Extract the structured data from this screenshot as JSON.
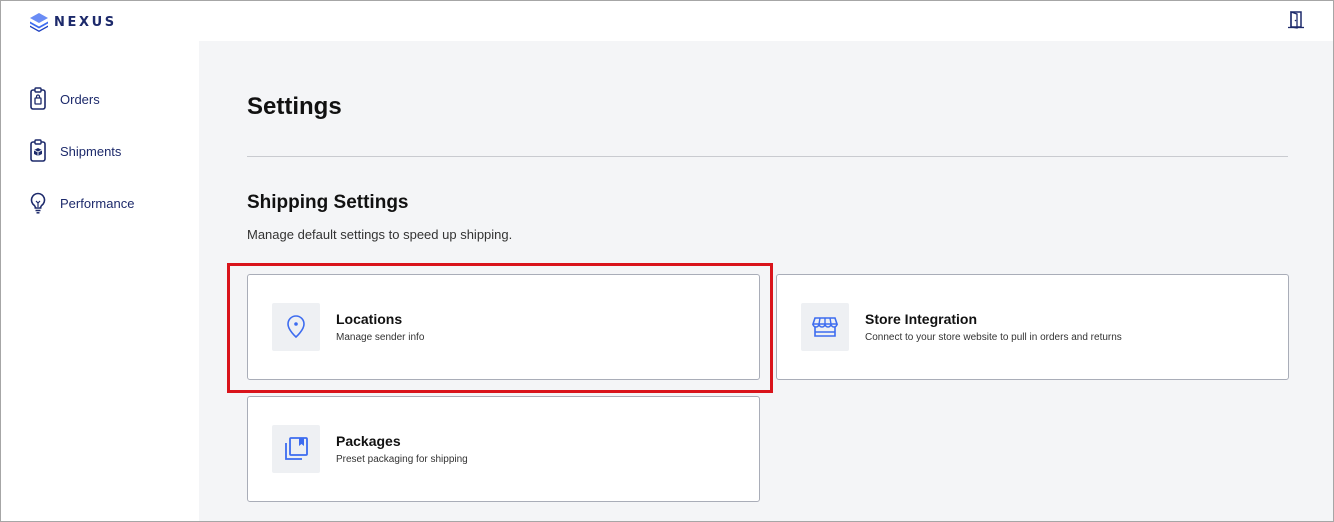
{
  "app": {
    "brand": "NEXUS",
    "brand_color": "#1d2a6b",
    "accent_color": "#3d6cf0"
  },
  "header": {
    "exit_icon": "door-exit-icon"
  },
  "sidebar": {
    "items": [
      {
        "label": "Orders",
        "icon": "clipboard-bag-icon"
      },
      {
        "label": "Shipments",
        "icon": "clipboard-box-icon"
      },
      {
        "label": "Performance",
        "icon": "lightbulb-icon"
      }
    ]
  },
  "main": {
    "title": "Settings",
    "section": {
      "title": "Shipping Settings",
      "subtitle": "Manage default settings to speed up shipping."
    },
    "cards": [
      {
        "title": "Locations",
        "description": "Manage sender info",
        "icon": "location-pin-icon",
        "highlighted": true
      },
      {
        "title": "Store Integration",
        "description": "Connect to your store website to pull in orders and returns",
        "icon": "storefront-icon",
        "highlighted": false
      },
      {
        "title": "Packages",
        "description": "Preset packaging for shipping",
        "icon": "packages-icon",
        "highlighted": false
      }
    ],
    "highlight_color": "#d9141b"
  }
}
